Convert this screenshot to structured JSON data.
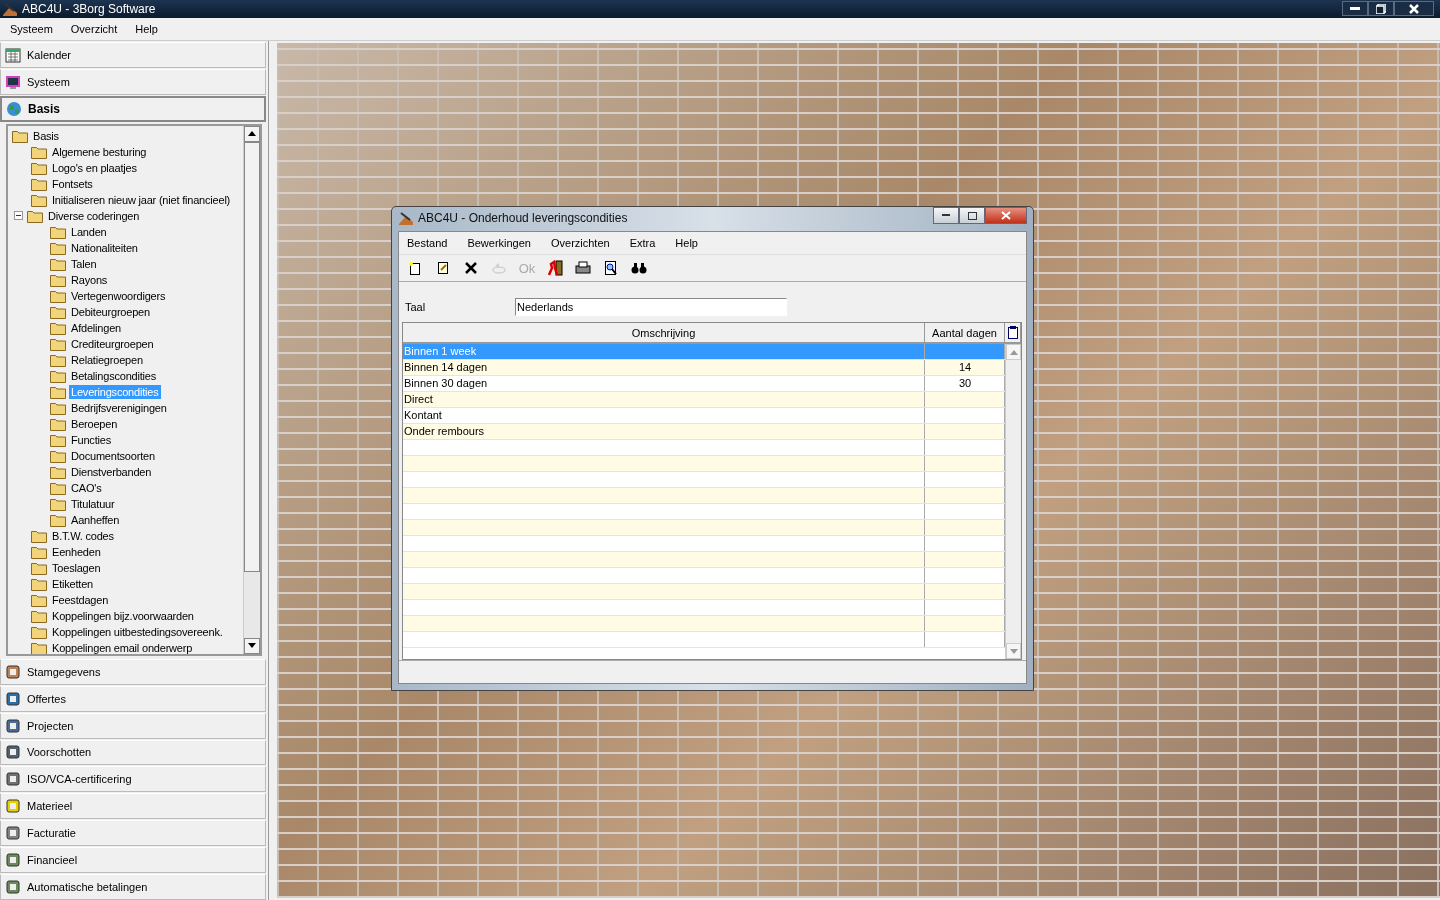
{
  "window": {
    "title": "ABC4U - 3Borg Software"
  },
  "menu": [
    "Systeem",
    "Overzicht",
    "Help"
  ],
  "nav_top": [
    {
      "label": "Kalender",
      "selected": false
    },
    {
      "label": "Systeem",
      "selected": false
    },
    {
      "label": "Basis",
      "selected": true
    }
  ],
  "tree": [
    {
      "label": "Basis",
      "selected": false,
      "children": [
        {
          "label": "Algemene besturing",
          "selected": false
        },
        {
          "label": "Logo's en plaatjes",
          "selected": false
        },
        {
          "label": "Fontsets",
          "selected": false
        },
        {
          "label": "Initialiseren nieuw jaar (niet financieel)",
          "selected": false
        },
        {
          "label": "Diverse coderingen",
          "selected": false,
          "children": [
            {
              "label": "Landen",
              "selected": false
            },
            {
              "label": "Nationaliteiten",
              "selected": false
            },
            {
              "label": "Talen",
              "selected": false
            },
            {
              "label": "Rayons",
              "selected": false
            },
            {
              "label": "Vertegenwoordigers",
              "selected": false
            },
            {
              "label": "Debiteurgroepen",
              "selected": false
            },
            {
              "label": "Afdelingen",
              "selected": false
            },
            {
              "label": "Crediteurgroepen",
              "selected": false
            },
            {
              "label": "Relatiegroepen",
              "selected": false
            },
            {
              "label": "Betalingscondities",
              "selected": false
            },
            {
              "label": "Leveringscondities",
              "selected": true
            },
            {
              "label": "Bedrijfsverenigingen",
              "selected": false
            },
            {
              "label": "Beroepen",
              "selected": false
            },
            {
              "label": "Functies",
              "selected": false
            },
            {
              "label": "Documentsoorten",
              "selected": false
            },
            {
              "label": "Dienstverbanden",
              "selected": false
            },
            {
              "label": "CAO's",
              "selected": false
            },
            {
              "label": "Titulatuur",
              "selected": false
            },
            {
              "label": "Aanheffen",
              "selected": false
            }
          ]
        },
        {
          "label": "B.T.W. codes",
          "selected": false
        },
        {
          "label": "Eenheden",
          "selected": false
        },
        {
          "label": "Toeslagen",
          "selected": false
        },
        {
          "label": "Etiketten",
          "selected": false
        },
        {
          "label": "Feestdagen",
          "selected": false
        },
        {
          "label": "Koppelingen bijz.voorwaarden",
          "selected": false
        },
        {
          "label": "Koppelingen uitbestedingsovereenk.",
          "selected": false
        },
        {
          "label": "Koppelingen email onderwerp",
          "selected": false
        }
      ]
    }
  ],
  "nav_bottom": [
    {
      "label": "Stamgegevens",
      "selected": false
    },
    {
      "label": "Offertes",
      "selected": false
    },
    {
      "label": "Projecten",
      "selected": false
    },
    {
      "label": "Voorschotten",
      "selected": false
    },
    {
      "label": "ISO/VCA-certificering",
      "selected": false
    },
    {
      "label": "Materieel",
      "selected": false
    },
    {
      "label": "Facturatie",
      "selected": false
    },
    {
      "label": "Financieel",
      "selected": false
    },
    {
      "label": "Automatische betalingen",
      "selected": false
    }
  ],
  "dialog": {
    "title": "ABC4U - Onderhoud leveringscondities",
    "menu": [
      "Bestand",
      "Bewerkingen",
      "Overzichten",
      "Extra",
      "Help"
    ],
    "toolbar": [
      {
        "kind": "new",
        "disabled": false
      },
      {
        "kind": "edit",
        "disabled": false
      },
      {
        "kind": "delete",
        "disabled": false
      },
      {
        "kind": "undo",
        "disabled": true
      },
      {
        "kind": "ok",
        "label": "Ok",
        "disabled": true
      },
      {
        "kind": "exit",
        "disabled": false
      },
      {
        "kind": "print",
        "disabled": false
      },
      {
        "kind": "preview",
        "disabled": false
      },
      {
        "kind": "find",
        "disabled": false
      }
    ],
    "field": {
      "label": "Taal",
      "value": "Nederlands"
    },
    "table": {
      "columns": [
        "Omschrijving",
        "Aantal dagen"
      ],
      "rows": [
        {
          "cells": [
            "Binnen 1 week",
            ""
          ],
          "selected": true
        },
        {
          "cells": [
            "Binnen 14 dagen",
            "14"
          ],
          "selected": false
        },
        {
          "cells": [
            "Binnen 30 dagen",
            "30"
          ],
          "selected": false
        },
        {
          "cells": [
            "Direct",
            ""
          ],
          "selected": false
        },
        {
          "cells": [
            "Kontant",
            ""
          ],
          "selected": false
        },
        {
          "cells": [
            "Onder rembours",
            ""
          ],
          "selected": false
        }
      ]
    }
  }
}
